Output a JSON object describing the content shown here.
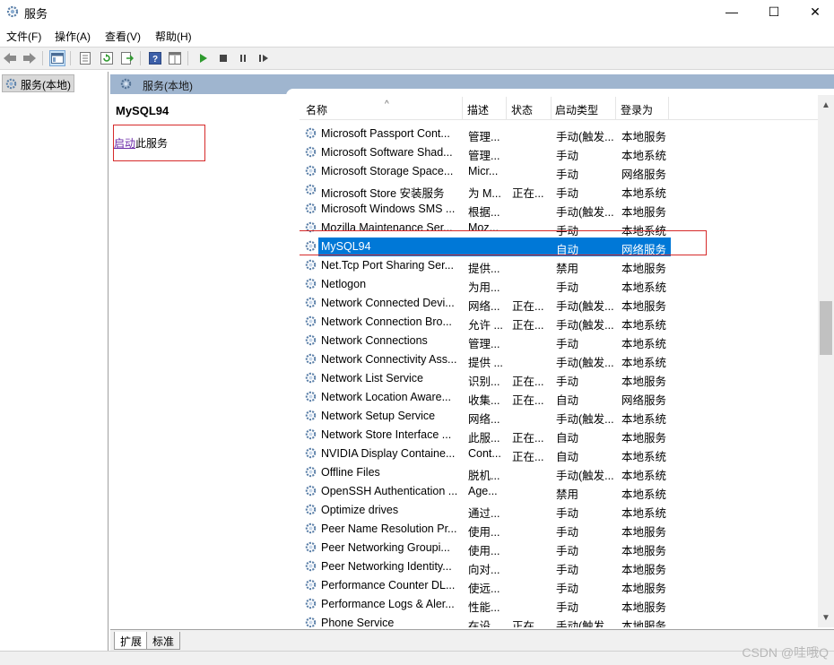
{
  "window": {
    "title": "服务",
    "min_glyph": "—",
    "max_glyph": "☐",
    "close_glyph": "✕"
  },
  "menu": {
    "items": [
      "文件(F)",
      "操作(A)",
      "查看(V)",
      "帮助(H)"
    ]
  },
  "tree": {
    "item": "服务(本地)"
  },
  "panel": {
    "title": "服务(本地)"
  },
  "detail": {
    "service_name": "MySQL94",
    "action_link": "启动",
    "action_rest": "此服务"
  },
  "columns": {
    "name": "名称",
    "desc": "描述",
    "status": "状态",
    "startup": "启动类型",
    "logon": "登录为"
  },
  "services": [
    {
      "name": "Microsoft Passport Cont...",
      "desc": "管理...",
      "status": "",
      "startup": "手动(触发...",
      "logon": "本地服务"
    },
    {
      "name": "Microsoft Software Shad...",
      "desc": "管理...",
      "status": "",
      "startup": "手动",
      "logon": "本地系统"
    },
    {
      "name": "Microsoft Storage Space...",
      "desc": "Micr...",
      "status": "",
      "startup": "手动",
      "logon": "网络服务"
    },
    {
      "name": "Microsoft Store 安装服务",
      "desc": "为 M...",
      "status": "正在...",
      "startup": "手动",
      "logon": "本地系统"
    },
    {
      "name": "Microsoft Windows SMS ...",
      "desc": "根据...",
      "status": "",
      "startup": "手动(触发...",
      "logon": "本地服务"
    },
    {
      "name": "Mozilla Maintenance Ser...",
      "desc": "Moz...",
      "status": "",
      "startup": "手动",
      "logon": "本地系统"
    },
    {
      "name": "MySQL94",
      "desc": "",
      "status": "",
      "startup": "自动",
      "logon": "网络服务"
    },
    {
      "name": "Net.Tcp Port Sharing Ser...",
      "desc": "提供...",
      "status": "",
      "startup": "禁用",
      "logon": "本地服务"
    },
    {
      "name": "Netlogon",
      "desc": "为用...",
      "status": "",
      "startup": "手动",
      "logon": "本地系统"
    },
    {
      "name": "Network Connected Devi...",
      "desc": "网络...",
      "status": "正在...",
      "startup": "手动(触发...",
      "logon": "本地服务"
    },
    {
      "name": "Network Connection Bro...",
      "desc": "允许 ...",
      "status": "正在...",
      "startup": "手动(触发...",
      "logon": "本地系统"
    },
    {
      "name": "Network Connections",
      "desc": "管理...",
      "status": "",
      "startup": "手动",
      "logon": "本地系统"
    },
    {
      "name": "Network Connectivity Ass...",
      "desc": "提供 ...",
      "status": "",
      "startup": "手动(触发...",
      "logon": "本地系统"
    },
    {
      "name": "Network List Service",
      "desc": "识别...",
      "status": "正在...",
      "startup": "手动",
      "logon": "本地服务"
    },
    {
      "name": "Network Location Aware...",
      "desc": "收集...",
      "status": "正在...",
      "startup": "自动",
      "logon": "网络服务"
    },
    {
      "name": "Network Setup Service",
      "desc": "网络...",
      "status": "",
      "startup": "手动(触发...",
      "logon": "本地系统"
    },
    {
      "name": "Network Store Interface ...",
      "desc": "此服...",
      "status": "正在...",
      "startup": "自动",
      "logon": "本地服务"
    },
    {
      "name": "NVIDIA Display Containe...",
      "desc": "Cont...",
      "status": "正在...",
      "startup": "自动",
      "logon": "本地系统"
    },
    {
      "name": "Offline Files",
      "desc": "脱机...",
      "status": "",
      "startup": "手动(触发...",
      "logon": "本地系统"
    },
    {
      "name": "OpenSSH Authentication ...",
      "desc": "Age...",
      "status": "",
      "startup": "禁用",
      "logon": "本地系统"
    },
    {
      "name": "Optimize drives",
      "desc": "通过...",
      "status": "",
      "startup": "手动",
      "logon": "本地系统"
    },
    {
      "name": "Peer Name Resolution Pr...",
      "desc": "使用...",
      "status": "",
      "startup": "手动",
      "logon": "本地服务"
    },
    {
      "name": "Peer Networking Groupi...",
      "desc": "使用...",
      "status": "",
      "startup": "手动",
      "logon": "本地服务"
    },
    {
      "name": "Peer Networking Identity...",
      "desc": "向对...",
      "status": "",
      "startup": "手动",
      "logon": "本地服务"
    },
    {
      "name": "Performance Counter DL...",
      "desc": "使远...",
      "status": "",
      "startup": "手动",
      "logon": "本地服务"
    },
    {
      "name": "Performance Logs & Aler...",
      "desc": "性能...",
      "status": "",
      "startup": "手动",
      "logon": "本地服务"
    },
    {
      "name": "Phone Service",
      "desc": "在设...",
      "status": "正在...",
      "startup": "手动(触发...",
      "logon": "本地服务"
    }
  ],
  "selected_service": "MySQL94",
  "tabs": [
    "扩展",
    "标准"
  ],
  "watermark": "CSDN @哇哦Q",
  "colors": {
    "selection": "#0078d7",
    "header_band": "#9fb5cf",
    "highlight_box": "#d62a2a",
    "link": "#6b2aa8"
  }
}
